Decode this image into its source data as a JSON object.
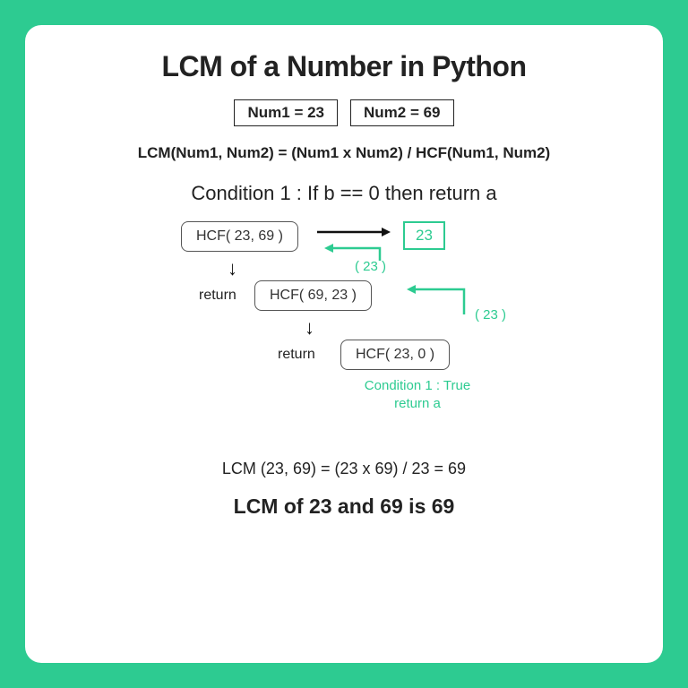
{
  "title": "LCM of a Number in Python",
  "num1": "Num1 = 23",
  "num2": "Num2 = 69",
  "formula": "LCM(Num1, Num2) = (Num1 x Num2) / HCF(Num1, Num2)",
  "condition": "Condition 1 : If  b == 0  then return a",
  "hcf1": "HCF( 23, 69 )",
  "hcf2": "HCF( 69, 23 )",
  "hcf3": "HCF( 23, 0 )",
  "result": "23",
  "paren23a": "( 23 )",
  "paren23b": "( 23 )",
  "return1": "return",
  "return2": "return",
  "cond_true": "Condition 1 : True\nreturn a",
  "calc": "LCM (23, 69) = (23 x 69) / 23 = 69",
  "answer": "LCM of 23 and 69 is 69"
}
